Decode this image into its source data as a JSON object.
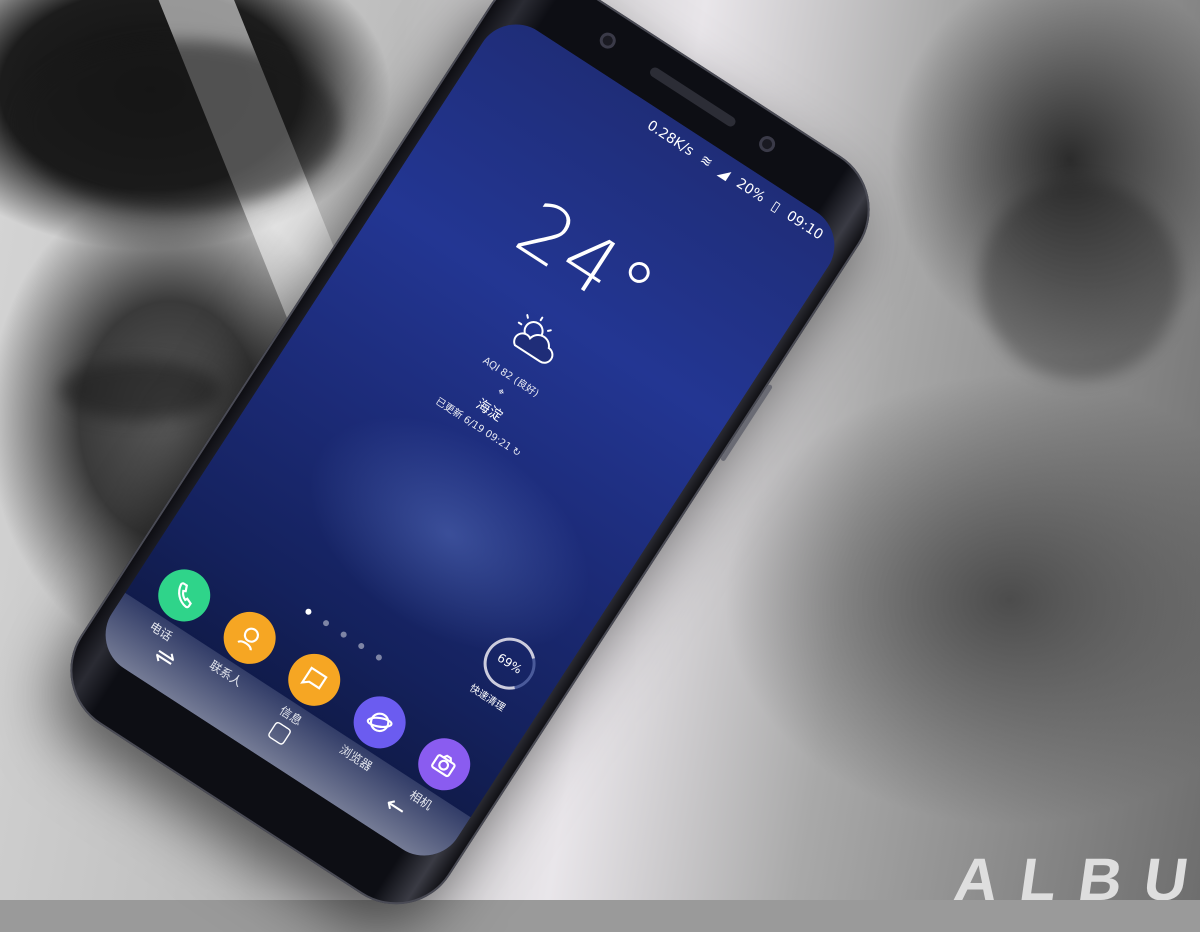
{
  "status_bar": {
    "network_speed": "0.28K/s",
    "battery": "20%",
    "time": "09:10"
  },
  "lock_screen": {
    "temperature": "24°",
    "aqi": "AQI 82 (良好)",
    "location_icon": "location-pin-icon",
    "city": "海淀",
    "updated": "已更新 6/19 09:21"
  },
  "widgets": {
    "boost_value": "69%",
    "boost_label": "快速清理"
  },
  "dock": {
    "apps": [
      {
        "label": "电话",
        "icon": "phone-icon",
        "color": "#2fd48a"
      },
      {
        "label": "联系人",
        "icon": "contacts-icon",
        "color": "#f6a623"
      },
      {
        "label": "信息",
        "icon": "messages-icon",
        "color": "#f6a623"
      },
      {
        "label": "浏览器",
        "icon": "browser-icon",
        "color": "#6b5cf0"
      },
      {
        "label": "相机",
        "icon": "camera-icon",
        "color": "#8a5cf0"
      }
    ]
  },
  "nav": {
    "recents": "⇌",
    "home": "▢",
    "back": "←"
  },
  "background": {
    "letters": "ALBU"
  }
}
